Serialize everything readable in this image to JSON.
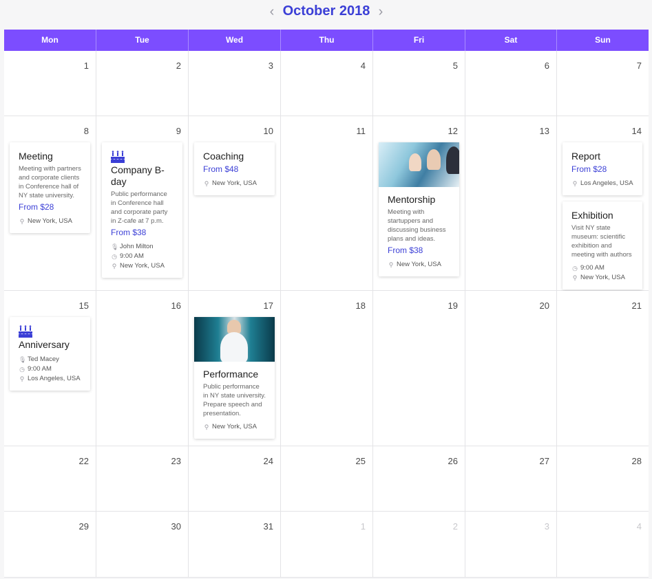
{
  "header": {
    "title": "October 2018",
    "prev_icon": "chevron-left-icon",
    "next_icon": "chevron-right-icon",
    "prev_glyph": "‹",
    "next_glyph": "›"
  },
  "colors": {
    "accent": "#7c4dff",
    "title": "#3b3fd6",
    "price": "#3b3fd6"
  },
  "weekdays": [
    "Mon",
    "Tue",
    "Wed",
    "Thu",
    "Fri",
    "Sat",
    "Sun"
  ],
  "weeks": [
    [
      {
        "day": "1"
      },
      {
        "day": "2"
      },
      {
        "day": "3"
      },
      {
        "day": "4"
      },
      {
        "day": "5"
      },
      {
        "day": "6"
      },
      {
        "day": "7"
      }
    ],
    [
      {
        "day": "8",
        "events": [
          {
            "type": "event",
            "title": "Meeting",
            "desc": "Meeting with partners and corporate clients in Conference hall of NY state university.",
            "price": "From $28",
            "location": "New York, USA"
          }
        ]
      },
      {
        "day": "9",
        "events": [
          {
            "type": "birthday",
            "icon": "cake-icon",
            "title": "Company B-day",
            "desc": "Public performance in Conference hall and corporate party in Z-cafe at 7 p.m.",
            "price": "From $38",
            "speaker": "John Milton",
            "time": "9:00 AM",
            "location": "New York, USA"
          }
        ]
      },
      {
        "day": "10",
        "events": [
          {
            "type": "event",
            "title": "Coaching",
            "price": "From $48",
            "location": "New York, USA"
          }
        ]
      },
      {
        "day": "11"
      },
      {
        "day": "12",
        "events": [
          {
            "type": "photo",
            "image": "office",
            "title": "Mentorship",
            "desc": "Meeting with startuppers and discussing business plans and ideas.",
            "price": "From $38",
            "location": "New York, USA"
          }
        ]
      },
      {
        "day": "13"
      },
      {
        "day": "14",
        "events": [
          {
            "type": "event",
            "title": "Report",
            "price": "From $28",
            "location": "Los Angeles, USA"
          },
          {
            "type": "event",
            "title": "Exhibition",
            "desc": "Visit NY state museum: scientific exhibition and meeting with authors",
            "time": "9:00 AM",
            "location": "New York, USA"
          }
        ]
      }
    ],
    [
      {
        "day": "15",
        "events": [
          {
            "type": "birthday",
            "icon": "cake-icon",
            "title": "Anniversary",
            "speaker": "Ted Macey",
            "time": "9:00 AM",
            "location": "Los Angeles, USA"
          }
        ]
      },
      {
        "day": "16"
      },
      {
        "day": "17",
        "events": [
          {
            "type": "photo",
            "image": "tech",
            "title": "Performance",
            "desc": "Public performance in NY state university. Prepare speech and presentation.",
            "location": "New York, USA"
          }
        ]
      },
      {
        "day": "18"
      },
      {
        "day": "19"
      },
      {
        "day": "20"
      },
      {
        "day": "21"
      }
    ],
    [
      {
        "day": "22"
      },
      {
        "day": "23"
      },
      {
        "day": "24"
      },
      {
        "day": "25"
      },
      {
        "day": "26"
      },
      {
        "day": "27"
      },
      {
        "day": "28"
      }
    ],
    [
      {
        "day": "29"
      },
      {
        "day": "30"
      },
      {
        "day": "31"
      },
      {
        "day": "1",
        "muted": true
      },
      {
        "day": "2",
        "muted": true
      },
      {
        "day": "3",
        "muted": true
      },
      {
        "day": "4",
        "muted": true
      }
    ]
  ],
  "icons": {
    "location": "map-pin-icon",
    "time": "clock-icon",
    "speaker": "microphone-icon"
  }
}
